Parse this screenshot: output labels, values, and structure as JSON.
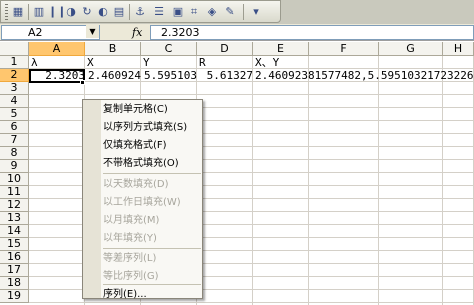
{
  "toolbar": {
    "icons": [
      "sheet-icon",
      "chart-icon",
      "pause-icon",
      "chart2-icon",
      "refresh-icon",
      "rotate-icon",
      "align-icon",
      "rows-icon",
      "format-icon",
      "crop-icon",
      "pen-icon",
      "options-icon"
    ]
  },
  "formula_bar": {
    "name_box": "A2",
    "fx_label": "fx",
    "formula": "2.3203"
  },
  "sheet": {
    "columns": [
      "A",
      "B",
      "C",
      "D",
      "E",
      "F",
      "G",
      "H"
    ],
    "rows": [
      "1",
      "2",
      "3",
      "4",
      "5",
      "6",
      "7",
      "8",
      "9",
      "10",
      "11",
      "12",
      "13",
      "14",
      "15",
      "16",
      "17",
      "18",
      "19"
    ],
    "cells": {
      "A1": "λ",
      "B1": "X",
      "C1": "Y",
      "D1": "R",
      "E1": "X、Y",
      "A2": "2.3203",
      "B2": "2.460924",
      "C2": "5.595103",
      "D2": "5.61327",
      "E2": "2.46092381577482,5.59510321723226"
    }
  },
  "context_menu": {
    "items": [
      {
        "label": "复制单元格(C)",
        "enabled": true
      },
      {
        "label": "以序列方式填充(S)",
        "enabled": true
      },
      {
        "label": "仅填充格式(F)",
        "enabled": true
      },
      {
        "label": "不带格式填充(O)",
        "enabled": true
      },
      {
        "label": "以天数填充(D)",
        "enabled": false
      },
      {
        "label": "以工作日填充(W)",
        "enabled": false
      },
      {
        "label": "以月填充(M)",
        "enabled": false
      },
      {
        "label": "以年填充(Y)",
        "enabled": false
      },
      {
        "label": "等差序列(L)",
        "enabled": false
      },
      {
        "label": "等比序列(G)",
        "enabled": false
      },
      {
        "label": "序列(E)...",
        "enabled": true
      }
    ]
  }
}
